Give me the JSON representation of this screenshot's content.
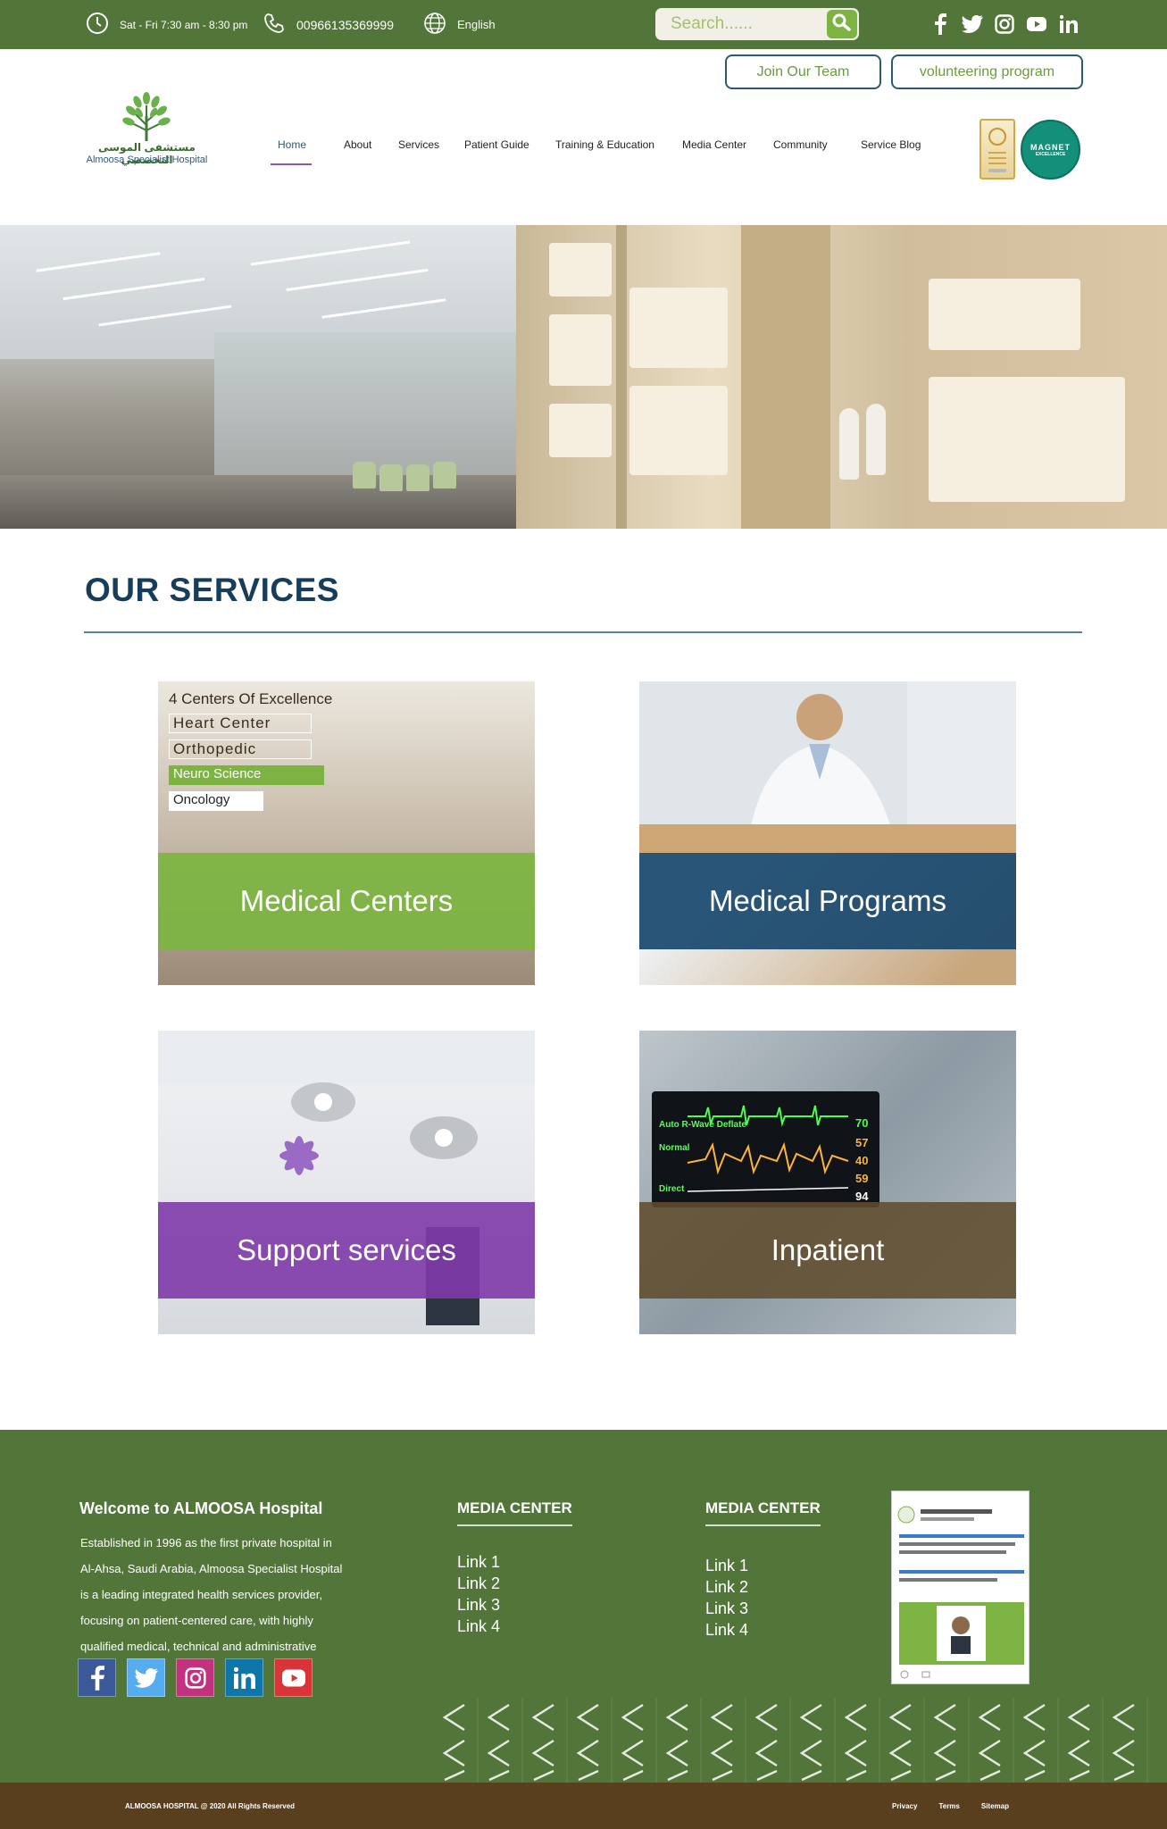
{
  "topbar": {
    "hours": "Sat - Fri 7:30 am - 8:30 pm",
    "phone": "00966135369999",
    "language": "English",
    "search_placeholder": "Search......",
    "social": [
      "facebook-icon",
      "twitter-icon",
      "instagram-icon",
      "youtube-icon",
      "linkedin-icon"
    ]
  },
  "header": {
    "join_label": "Join Our Team",
    "volunteer_label": "volunteering program",
    "logo_ar": "مستشفى الموسى التخصصي",
    "logo_en": "Almoosa Specialist Hospital",
    "nav": [
      "Home",
      "About",
      "Services",
      "Patient Guide",
      "Training & Education",
      "Media Center",
      "Community",
      "Service Blog"
    ],
    "active_nav": "Home",
    "badge2_text": "MAGNET",
    "badge2_sub": "EXCELLENCE"
  },
  "services": {
    "title": "OUR SERVICES",
    "cards": [
      {
        "label": "Medical Centers"
      },
      {
        "label": "Medical Programs"
      },
      {
        "label": "Support services"
      },
      {
        "label": "Inpatient"
      }
    ],
    "centers": {
      "heading": "4 Centers Of Excellence",
      "items": [
        "Heart Center",
        "Orthopedic",
        "Neuro Science",
        "Oncology"
      ]
    },
    "monitor": {
      "label1": "Auto R-Wave Deflate",
      "label2": "Normal",
      "label3": "Direct",
      "nums": [
        "70",
        "57",
        "40",
        "59",
        "94"
      ]
    }
  },
  "footer": {
    "welcome_title": "Welcome to ALMOOSA Hospital",
    "welcome_lines": [
      "Established in 1996 as the first private hospital in",
      "Al-Ahsa, Saudi Arabia, Almoosa Specialist Hospital",
      " is a leading integrated health services provider,",
      " focusing on patient-centered care, with highly",
      "qualified medical, technical and administrative"
    ],
    "col1": {
      "title": "MEDIA CENTER",
      "links": [
        "Link 1",
        "Link 2",
        "Link 3",
        "Link 4"
      ]
    },
    "col2": {
      "title": "MEDIA CENTER",
      "links": [
        "Link 1",
        "Link 2",
        "Link 3",
        "Link 4"
      ]
    },
    "social": [
      "facebook-icon",
      "twitter-icon",
      "instagram-icon",
      "linkedin-icon",
      "youtube-icon"
    ],
    "copyright": "ALMOOSA HOSPITAL @ 2020 All Rights Reserved",
    "bottom_links": [
      "Privacy",
      "Terms",
      "Sitemap"
    ]
  },
  "colors": {
    "brand_green": "#52753a",
    "accent_green": "#7cb342",
    "navy": "#173d5a",
    "purple": "#7f3aaa",
    "brown": "#5a3f1f"
  }
}
